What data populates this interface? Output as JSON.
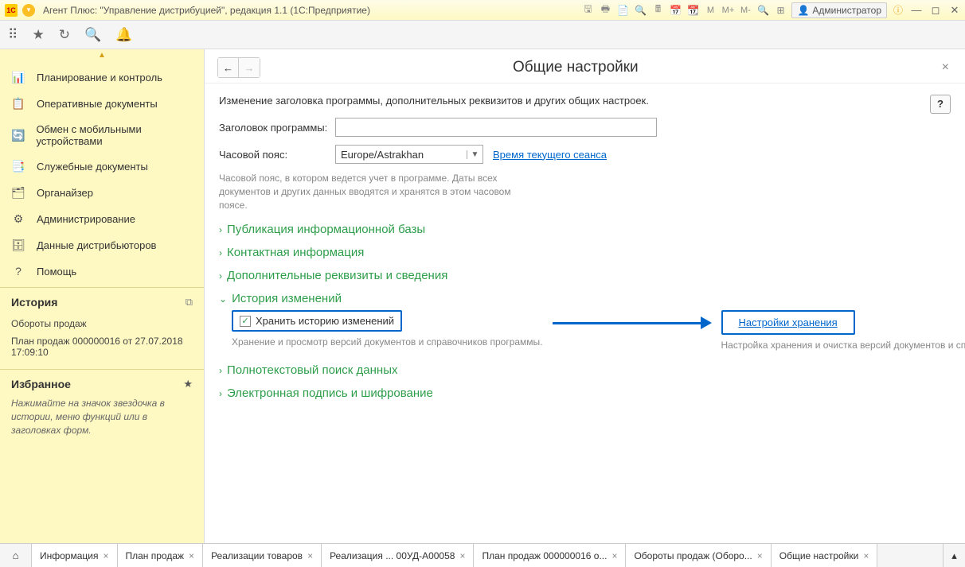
{
  "titlebar": {
    "title": "Агент Плюс: \"Управление дистрибуцией\", редакция 1.1  (1С:Предприятие)",
    "user": "Администратор",
    "m_labels": [
      "M",
      "M+",
      "M-"
    ]
  },
  "sidebar": {
    "items": [
      {
        "icon": "📊",
        "label": "Планирование и контроль"
      },
      {
        "icon": "📋",
        "label": "Оперативные документы"
      },
      {
        "icon": "🔄",
        "label": "Обмен с мобильными устройствами"
      },
      {
        "icon": "📑",
        "label": "Служебные документы"
      },
      {
        "icon": "🗂",
        "label": "Органайзер"
      },
      {
        "icon": "⚙",
        "label": "Администрирование"
      },
      {
        "icon": "🗄",
        "label": "Данные дистрибьюторов"
      },
      {
        "icon": "?",
        "label": "Помощь"
      }
    ],
    "history": {
      "title": "История",
      "items": [
        "Обороты продаж",
        "План продаж 000000016 от 27.07.2018 17:09:10"
      ]
    },
    "favorites": {
      "title": "Избранное",
      "hint": "Нажимайте на значок звездочка в истории, меню функций или в заголовках форм."
    }
  },
  "content": {
    "title": "Общие настройки",
    "description": "Изменение заголовка программы, дополнительных реквизитов и других общих настроек.",
    "form": {
      "program_title_label": "Заголовок программы:",
      "program_title_value": "",
      "timezone_label": "Часовой пояс:",
      "timezone_value": "Europe/Astrakhan",
      "session_time_link": "Время текущего сеанса",
      "timezone_hint": "Часовой пояс, в котором ведется учет в программе. Даты всех документов и других данных вводятся и хранятся в этом часовом поясе."
    },
    "sections": [
      {
        "label": "Публикация информационной базы",
        "expanded": false
      },
      {
        "label": "Контактная информация",
        "expanded": false
      },
      {
        "label": "Дополнительные реквизиты и сведения",
        "expanded": false
      },
      {
        "label": "История изменений",
        "expanded": true
      },
      {
        "label": "Полнотекстовый поиск данных",
        "expanded": false
      },
      {
        "label": "Электронная подпись и шифрование",
        "expanded": false
      }
    ],
    "history_section": {
      "checkbox_label": "Хранить историю изменений",
      "checkbox_hint": "Хранение и просмотр версий документов и справочников программы.",
      "settings_link": "Настройки хранения",
      "settings_hint": "Настройка хранения и очистка версий документов и справочников."
    }
  },
  "tabs": [
    {
      "label": "Информация"
    },
    {
      "label": "План продаж"
    },
    {
      "label": "Реализации товаров"
    },
    {
      "label": "Реализация ...  00УД-А00058"
    },
    {
      "label": "План продаж 000000016 о..."
    },
    {
      "label": "Обороты продаж (Оборо..."
    },
    {
      "label": "Общие настройки",
      "active": true
    }
  ]
}
